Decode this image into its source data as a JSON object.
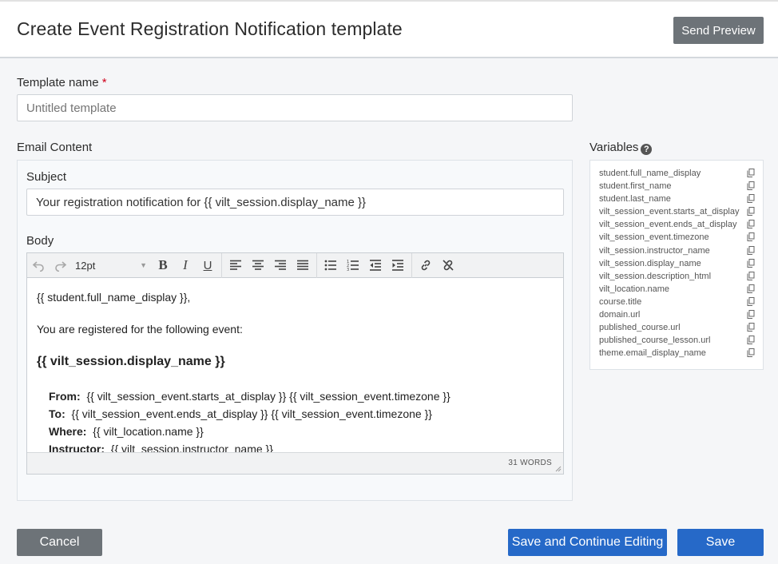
{
  "header": {
    "title": "Create Event Registration Notification template",
    "send_preview_label": "Send Preview"
  },
  "template_name": {
    "label": "Template name",
    "required_mark": "*",
    "placeholder": "Untitled template"
  },
  "email_content": {
    "label": "Email Content",
    "subject_label": "Subject",
    "subject_value": "Your registration notification for {{ vilt_session.display_name }}",
    "body_label": "Body",
    "font_size": "12pt",
    "word_count": "31 WORDS",
    "body": {
      "greeting": "{{ student.full_name_display }},",
      "intro": "You are registered for the following event:",
      "heading": "{{ vilt_session.display_name }}",
      "rows": [
        {
          "label": "From:",
          "value": "{{ vilt_session_event.starts_at_display }} {{ vilt_session_event.timezone }}"
        },
        {
          "label": "To:",
          "value": "{{ vilt_session_event.ends_at_display }} {{ vilt_session_event.timezone }}"
        },
        {
          "label": "Where:",
          "value": "{{ vilt_location.name }}"
        },
        {
          "label": "Instructor:",
          "value": "{{ vilt_session.instructor_name }}"
        }
      ]
    }
  },
  "variables": {
    "title": "Variables",
    "help_glyph": "?",
    "items": [
      "student.full_name_display",
      "student.first_name",
      "student.last_name",
      "vilt_session_event.starts_at_display",
      "vilt_session_event.ends_at_display",
      "vilt_session_event.timezone",
      "vilt_session.instructor_name",
      "vilt_session.display_name",
      "vilt_session.description_html",
      "vilt_location.name",
      "course.title",
      "domain.url",
      "published_course.url",
      "published_course_lesson.url",
      "theme.email_display_name"
    ]
  },
  "footer": {
    "cancel_label": "Cancel",
    "save_continue_label": "Save and Continue Editing",
    "save_label": "Save"
  },
  "colors": {
    "primary": "#2669c8",
    "secondary": "#6d7378",
    "required": "#d0021b"
  }
}
